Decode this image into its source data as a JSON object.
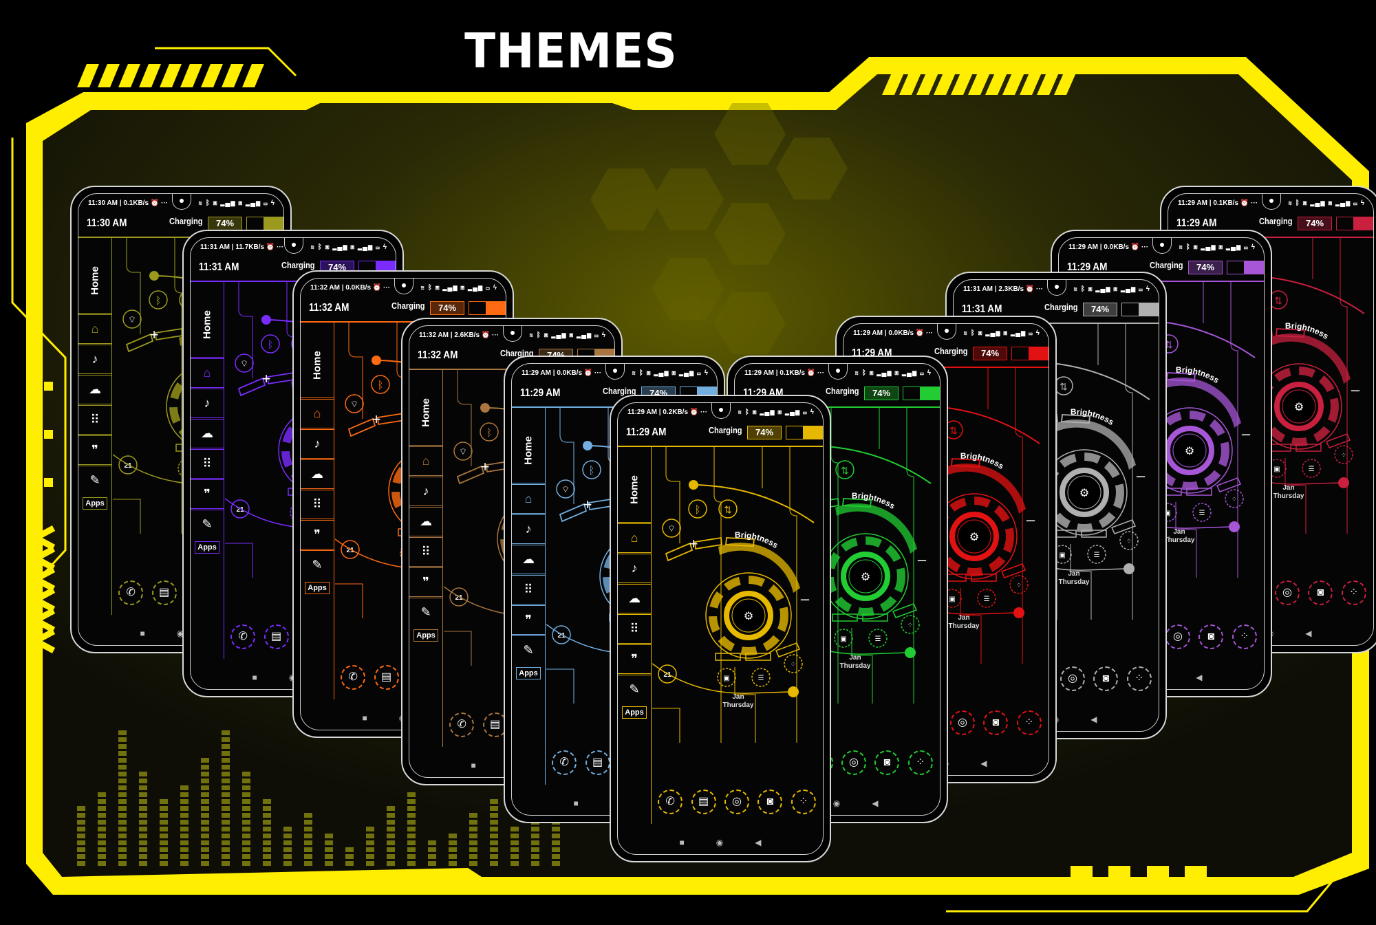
{
  "title": "THEMES",
  "colors": {
    "frame": "#ffee00",
    "background": "#000000",
    "glow": "#6b6b00"
  },
  "phone_common": {
    "charging": "Charging",
    "battery": "74%",
    "home": "Home",
    "apps": "Apps",
    "brightness": "Brightness",
    "date_month": "Jan",
    "date_day": "Thursday",
    "date_num": "21",
    "sidebar_icons": [
      "home-icon",
      "music-icon",
      "cloud-icon",
      "dialpad-icon",
      "chat-icon",
      "edit-icon"
    ],
    "dock_icons": [
      "phone-icon",
      "messages-icon",
      "chrome-icon",
      "camera-icon",
      "app-folder-icon"
    ],
    "widget_icons": [
      "wifi-icon",
      "bluetooth-icon",
      "data-transfer-icon",
      "settings-icon",
      "plus-icon",
      "minus-icon"
    ]
  },
  "phones": [
    {
      "theme": "olive",
      "status": "11:30 AM | 0.1KB/s",
      "clock": "11:30 AM",
      "color": "#9c9a1e"
    },
    {
      "theme": "purple",
      "status": "11:31 AM | 11.7KB/s",
      "clock": "11:31 AM",
      "color": "#7a2cff"
    },
    {
      "theme": "orange",
      "status": "11:32 AM | 0.0KB/s",
      "clock": "11:32 AM",
      "color": "#ff6a12"
    },
    {
      "theme": "brown",
      "status": "11:32 AM | 2.6KB/s",
      "clock": "11:32 AM",
      "color": "#a8763e"
    },
    {
      "theme": "light-blue",
      "status": "11:29 AM | 0.0KB/s",
      "clock": "11:29 AM",
      "color": "#72aee0"
    },
    {
      "theme": "yellow",
      "status": "11:29 AM | 0.2KB/s",
      "clock": "11:29 AM",
      "color": "#e6b800"
    },
    {
      "theme": "green",
      "status": "11:29 AM | 0.1KB/s",
      "clock": "11:29 AM",
      "color": "#22cc33"
    },
    {
      "theme": "red",
      "status": "11:29 AM | 0.0KB/s",
      "clock": "11:29 AM",
      "color": "#e31212"
    },
    {
      "theme": "gray",
      "status": "11:31 AM | 2.3KB/s",
      "clock": "11:31 AM",
      "color": "#b0b0b0"
    },
    {
      "theme": "violet",
      "status": "11:29 AM | 0.0KB/s",
      "clock": "11:29 AM",
      "color": "#a656d6"
    },
    {
      "theme": "crimson",
      "status": "11:29 AM | 0.1KB/s",
      "clock": "11:29 AM",
      "color": "#c8203e"
    }
  ]
}
